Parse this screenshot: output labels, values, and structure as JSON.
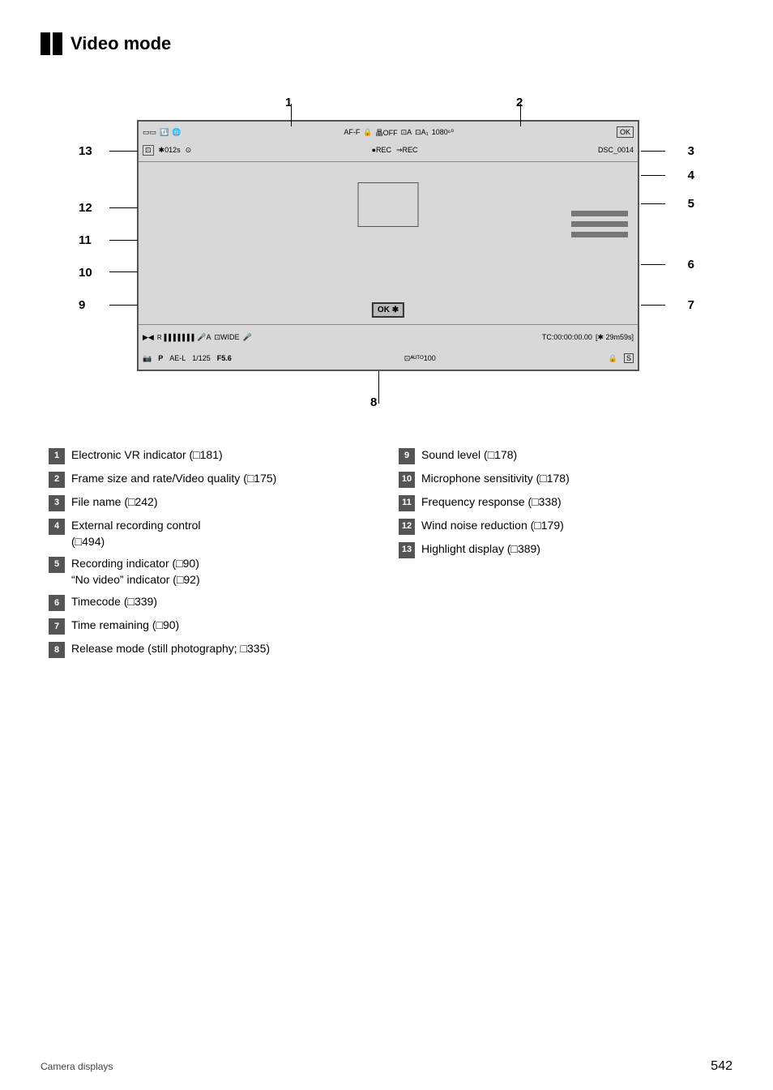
{
  "title": "Video mode",
  "diagram": {
    "numbers_left": [
      "13",
      "12",
      "11",
      "10",
      "9"
    ],
    "numbers_right": [
      "3",
      "4",
      "5",
      "6",
      "7"
    ],
    "number_top1": "1",
    "number_top2": "2",
    "number_bottom": "8",
    "vf_row1": "AF-F  🔒 晶OFF 🔲A  🔲A₁ 1080⚙  🔲",
    "vf_row2": "🔲  📷012s ⓖ       ●REC  ⇒REC       DSC_0014",
    "vf_bot_row1": "▶◀  R▓▓▓▓▓▓  🎤A  🔲WIDE  🎤    TC:00:00:00.00  [❄29m59s]",
    "vf_bot_row2": "📷  P AE-L  1/125  F5.6          🔲▓100       🔒 🔲"
  },
  "legend": {
    "left": [
      {
        "num": "1",
        "text": "Electronic VR indicator (□181)"
      },
      {
        "num": "2",
        "text": "Frame size and rate/Video quality (□175)"
      },
      {
        "num": "3",
        "text": "File name (□242)"
      },
      {
        "num": "4",
        "text": "External recording control (□494)"
      },
      {
        "num": "5",
        "text": "Recording indicator (□90)\n\"No video\" indicator (□92)"
      },
      {
        "num": "6",
        "text": "Timecode (□339)"
      },
      {
        "num": "7",
        "text": "Time remaining (□90)"
      },
      {
        "num": "8",
        "text": "Release mode (still photography; □335)"
      }
    ],
    "right": [
      {
        "num": "9",
        "text": "Sound level (□178)"
      },
      {
        "num": "10",
        "text": "Microphone sensitivity (□178)"
      },
      {
        "num": "11",
        "text": "Frequency response (□338)"
      },
      {
        "num": "12",
        "text": "Wind noise reduction (□179)"
      },
      {
        "num": "13",
        "text": "Highlight display (□389)"
      }
    ]
  },
  "footer": {
    "left": "Camera displays",
    "page": "542"
  }
}
